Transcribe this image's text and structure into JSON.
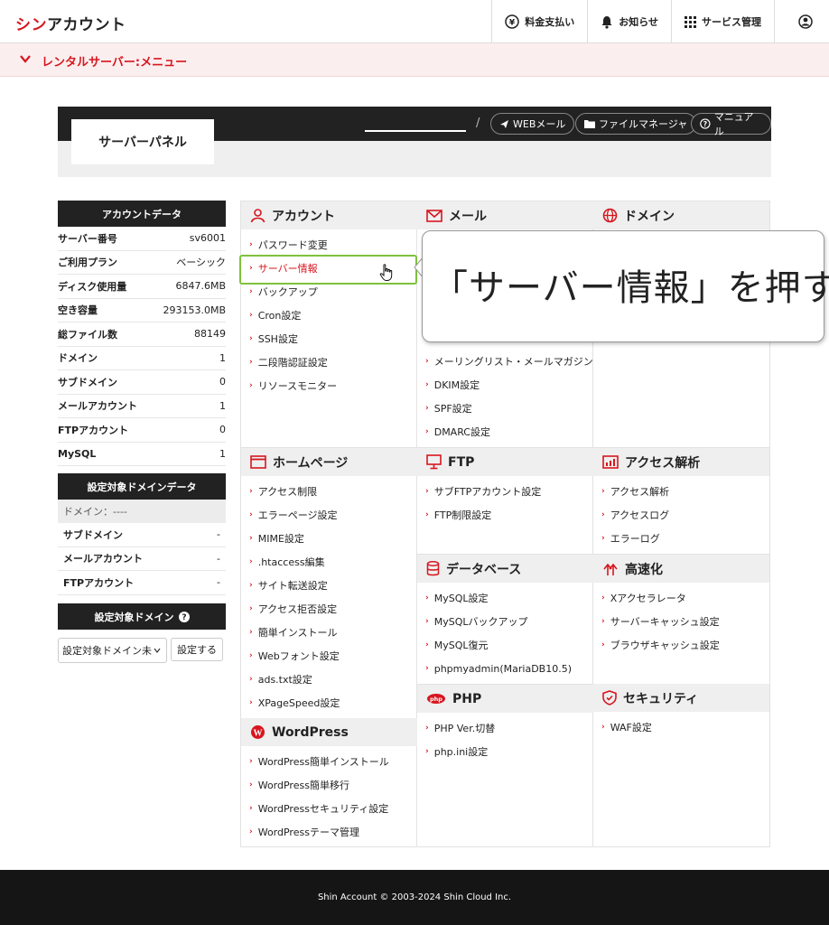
{
  "header": {
    "logo_red": "シン",
    "logo_black": "アカウント",
    "nav": {
      "payment": "料金支払い",
      "notice": "お知らせ",
      "service": "サービス管理"
    }
  },
  "menubar": {
    "title": "レンタルサーバー:メニュー"
  },
  "panel": {
    "tab": "サーバーパネル",
    "slash": "/",
    "webmail": "WEBメール",
    "filemanager": "ファイルマネージャ",
    "manual": "マニュアル"
  },
  "account_data": {
    "title": "アカウントデータ",
    "rows": [
      {
        "k": "サーバー番号",
        "v": "sv6001"
      },
      {
        "k": "ご利用プラン",
        "v": "ベーシック"
      },
      {
        "k": "ディスク使用量",
        "v": "6847.6MB"
      },
      {
        "k": "空き容量",
        "v": "293153.0MB"
      },
      {
        "k": "総ファイル数",
        "v": "88149"
      },
      {
        "k": "ドメイン",
        "v": "1"
      },
      {
        "k": "サブドメイン",
        "v": "0"
      },
      {
        "k": "メールアカウント",
        "v": "1"
      },
      {
        "k": "FTPアカウント",
        "v": "0"
      },
      {
        "k": "MySQL",
        "v": "1"
      }
    ]
  },
  "domain_data": {
    "title": "設定対象ドメインデータ",
    "domain_label": "ドメイン：----",
    "rows": [
      {
        "k": "サブドメイン",
        "v": "-"
      },
      {
        "k": "メールアカウント",
        "v": "-"
      },
      {
        "k": "FTPアカウント",
        "v": "-"
      }
    ]
  },
  "target_domain": {
    "title": "設定対象ドメイン",
    "select_value": "設定対象ドメイン未",
    "button": "設定する"
  },
  "sections": {
    "account": {
      "title": "アカウント",
      "links": [
        "パスワード変更",
        "サーバー情報",
        "バックアップ",
        "Cron設定",
        "SSH設定",
        "二段階認証設定",
        "リソースモニター"
      ]
    },
    "mail": {
      "title": "メール",
      "links": [
        "メーリングリスト・メールマガジン",
        "DKIM設定",
        "SPF設定",
        "DMARC設定"
      ]
    },
    "domain": {
      "title": "ドメイン"
    },
    "homepage": {
      "title": "ホームページ",
      "links": [
        "アクセス制限",
        "エラーページ設定",
        "MIME設定",
        ".htaccess編集",
        "サイト転送設定",
        "アクセス拒否設定",
        "簡単インストール",
        "Webフォント設定",
        "ads.txt設定",
        "XPageSpeed設定"
      ]
    },
    "ftp": {
      "title": "FTP",
      "links": [
        "サブFTPアカウント設定",
        "FTP制限設定"
      ]
    },
    "analytics": {
      "title": "アクセス解析",
      "links": [
        "アクセス解析",
        "アクセスログ",
        "エラーログ"
      ]
    },
    "database": {
      "title": "データベース",
      "links": [
        "MySQL設定",
        "MySQLバックアップ",
        "MySQL復元",
        "phpmyadmin(MariaDB10.5)"
      ]
    },
    "speed": {
      "title": "高速化",
      "links": [
        "Xアクセラレータ",
        "サーバーキャッシュ設定",
        "ブラウザキャッシュ設定"
      ]
    },
    "wordpress": {
      "title": "WordPress",
      "links": [
        "WordPress簡単インストール",
        "WordPress簡単移行",
        "WordPressセキュリティ設定",
        "WordPressテーマ管理"
      ]
    },
    "php": {
      "title": "PHP",
      "links": [
        "PHP Ver.切替",
        "php.ini設定"
      ]
    },
    "security": {
      "title": "セキュリティ",
      "links": [
        "WAF設定"
      ]
    }
  },
  "callout": {
    "text": "「サーバー情報」を押す"
  },
  "footer": {
    "text": "Shin Account © 2003-2024 Shin Cloud Inc."
  },
  "colors": {
    "accent": "#d7161e",
    "highlight": "#7ec13c",
    "dark": "#222222"
  }
}
